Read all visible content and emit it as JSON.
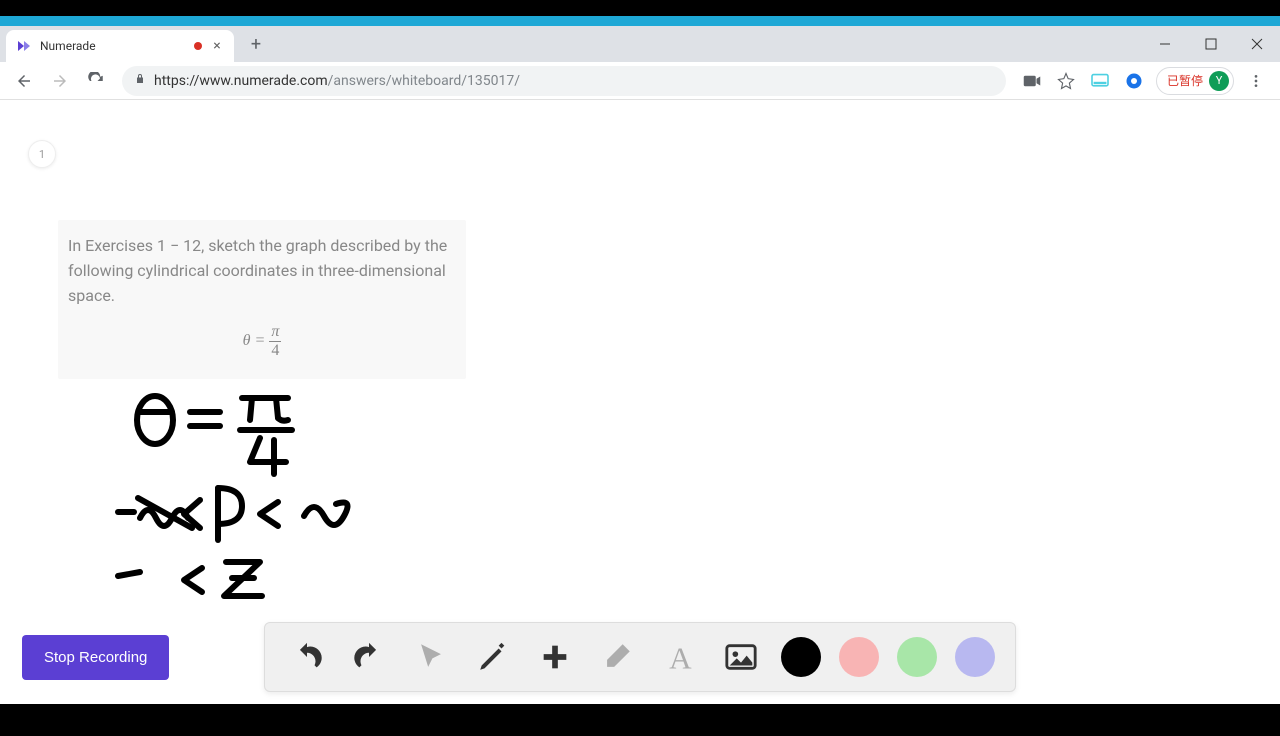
{
  "browser": {
    "tab_title": "Numerade",
    "url_domain": "https://www.numerade.com",
    "url_path": "/answers/whiteboard/135017/",
    "profile_status": "已暂停",
    "avatar_letter": "Y"
  },
  "page": {
    "page_number": "1",
    "problem_text_prefix": "In Exercises ",
    "problem_range": "1 − 12",
    "problem_text_suffix": ", sketch the graph described by the following cylindrical coordinates in three-dimensional space.",
    "equation_lhs": "θ = ",
    "equation_num": "π",
    "equation_den": "4"
  },
  "handwriting": {
    "line1": "θ = π/4",
    "line2": "-∞ < ρ < ∞",
    "line3": "-  < z"
  },
  "buttons": {
    "stop_recording": "Stop Recording"
  },
  "toolbar": {
    "undo": "undo",
    "redo": "redo",
    "pointer": "pointer",
    "pen": "pen",
    "plus": "plus",
    "eraser": "eraser",
    "text": "text",
    "image": "image"
  },
  "colors": {
    "black": "#000000",
    "pink": "#f8b4b4",
    "green": "#a8e6a8",
    "purple": "#b8b8f0"
  }
}
